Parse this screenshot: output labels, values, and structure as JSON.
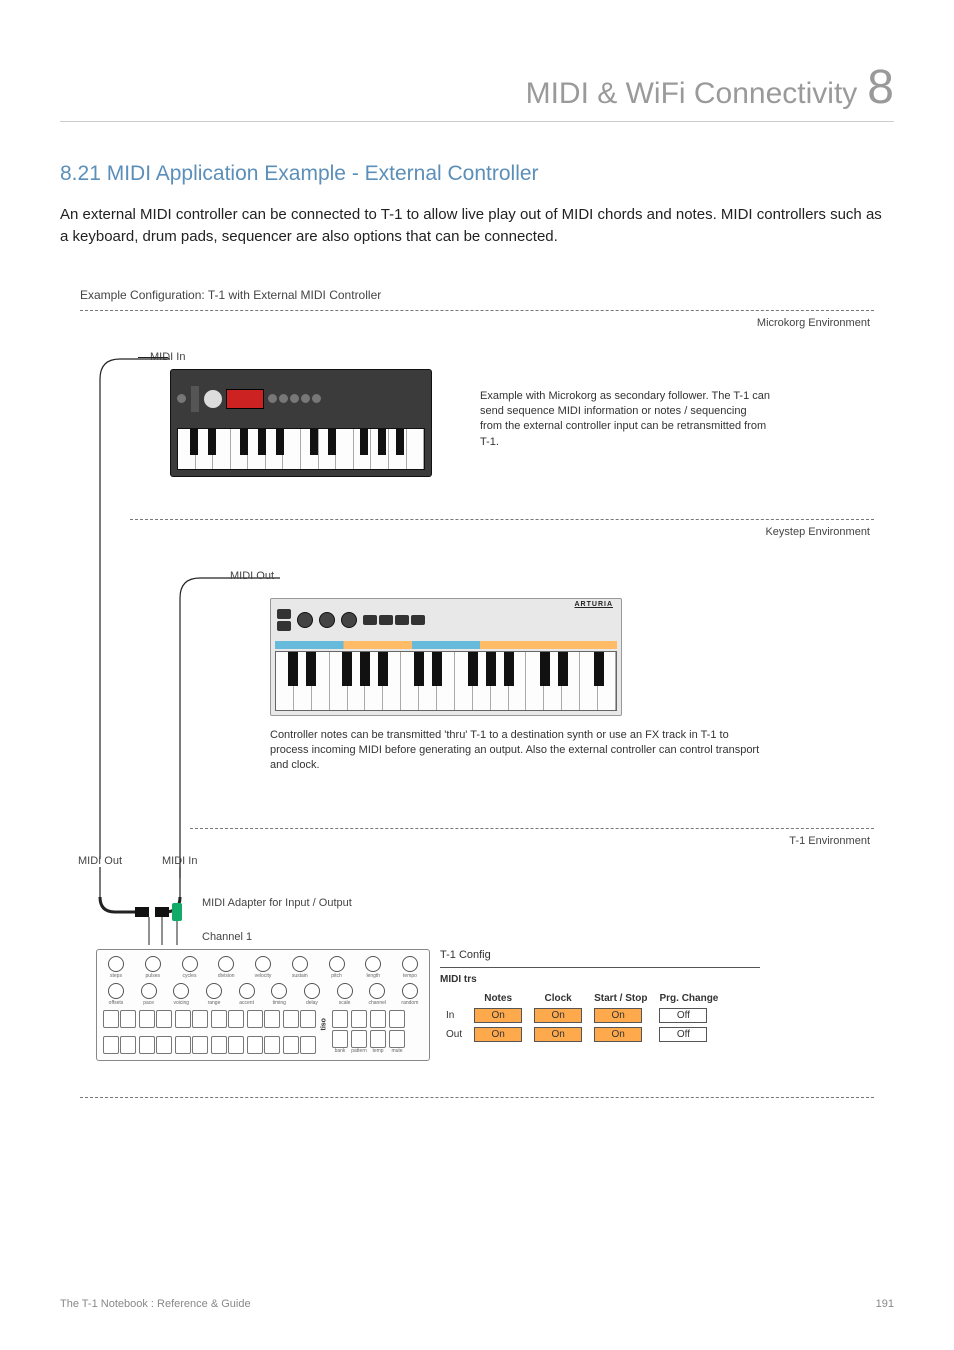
{
  "chapter": {
    "title": "MIDI & WiFi Connectivity",
    "number": "8"
  },
  "section": {
    "heading": "8.21 MIDI Application Example - External Controller"
  },
  "body": "An external MIDI controller can be connected to T-1 to allow live play out of MIDI chords and notes. MIDI controllers such as a keyboard, drum pads, sequencer are also options that can be connected.",
  "example_label": "Example Configuration: T-1 with External MIDI Controller",
  "env1": {
    "label": "Microkorg Environment",
    "midi_label": "MIDI In",
    "caption": "Example with Microkorg as secondary follower. The T-1 can send sequence MIDI information or notes / sequencing from the external controller input can be retransmitted from T-1."
  },
  "env2": {
    "label": "Keystep Environment",
    "midi_label": "MIDI Out",
    "brand": "ARTURIA",
    "caption": "Controller notes can be transmitted 'thru' T-1 to a destination synth or use an FX track in T-1 to process incoming MIDI before generating an output. Also the external controller can control transport and clock."
  },
  "env3": {
    "label": "T-1 Environment",
    "midi_out": "MIDI Out",
    "midi_in": "MIDI In",
    "adapter": "MIDI Adapter for Input / Output",
    "channel": "Channel 1",
    "logo": "tiso",
    "config_title": "T-1 Config",
    "config_sub": "MIDI trs",
    "knob_labels_row1": [
      "steps",
      "pulses",
      "cycles",
      "division",
      "velocity",
      "sustain",
      "pitch",
      "length",
      "tempo"
    ],
    "knob_labels_row2": [
      "offsets",
      "pace",
      "voicing",
      "range",
      "accent",
      "timing",
      "delay",
      "scale",
      "channel",
      "random"
    ],
    "pad_right": [
      "bank",
      "pattern",
      "temp",
      "mute"
    ],
    "table": {
      "cols": [
        "Notes",
        "Clock",
        "Start / Stop",
        "Prg. Change"
      ],
      "rows": [
        {
          "label": "In",
          "cells": [
            {
              "v": "On",
              "on": true
            },
            {
              "v": "On",
              "on": true
            },
            {
              "v": "On",
              "on": true
            },
            {
              "v": "Off",
              "on": false
            }
          ]
        },
        {
          "label": "Out",
          "cells": [
            {
              "v": "On",
              "on": true
            },
            {
              "v": "On",
              "on": true
            },
            {
              "v": "On",
              "on": true
            },
            {
              "v": "Off",
              "on": false
            }
          ]
        }
      ]
    }
  },
  "footer": {
    "left": "The T-1 Notebook : Reference & Guide",
    "right": "191"
  }
}
